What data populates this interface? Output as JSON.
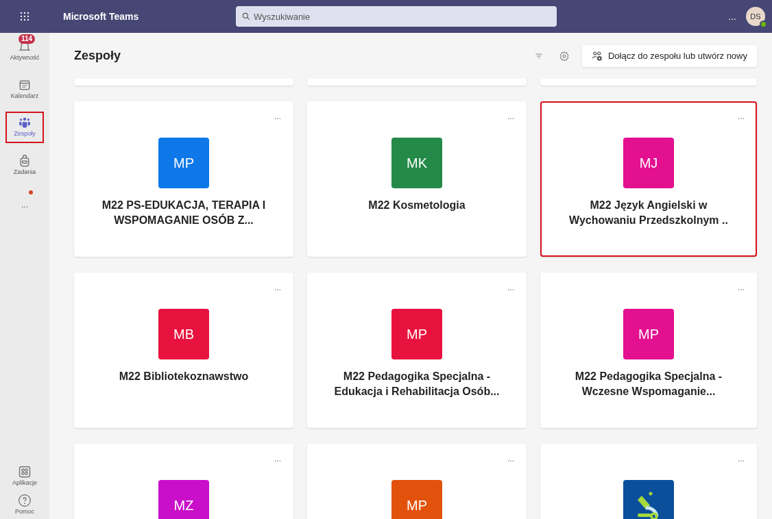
{
  "app_bar": {
    "title": "Microsoft Teams",
    "search": {
      "placeholder": "Wyszukiwanie"
    },
    "more": "...",
    "avatar": {
      "initials": "DS",
      "online": true
    }
  },
  "rail": [
    {
      "kind": "activity",
      "label": "Aktywność",
      "badge": "114",
      "selected": false,
      "highlighted": false
    },
    {
      "kind": "calendar",
      "label": "Kalendarz",
      "selected": false,
      "highlighted": false
    },
    {
      "kind": "teams",
      "label": "Zespoły",
      "selected": true,
      "highlighted": true
    },
    {
      "kind": "assignments",
      "label": "Zadania",
      "selected": false,
      "highlighted": false
    },
    {
      "kind": "more",
      "label": "...",
      "dot": true,
      "selected": false,
      "highlighted": false
    }
  ],
  "rail_bottom": [
    {
      "kind": "apps",
      "label": "Aplikacje"
    },
    {
      "kind": "help",
      "label": "Pomoc"
    }
  ],
  "header": {
    "title": "Zespoły",
    "join_button": "Dołącz do zespołu lub utwórz nowy"
  },
  "teams": [
    {
      "kind": "initials",
      "initials": "MP",
      "color": "#0f78e8",
      "name": "M22 PS-EDUKACJA, TERAPIA I WSPOMAGANIE OSÓB Z...",
      "more": "...",
      "highlighted": false
    },
    {
      "kind": "initials",
      "initials": "MK",
      "color": "#248a47",
      "name": "M22 Kosmetologia",
      "more": "...",
      "highlighted": false
    },
    {
      "kind": "initials",
      "initials": "MJ",
      "color": "#e3108f",
      "name": "M22 Język Angielski w Wychowaniu Przedszkolnym ..",
      "more": "...",
      "highlighted": true
    },
    {
      "kind": "initials",
      "initials": "MB",
      "color": "#e8123e",
      "name": "M22 Bibliotekoznawstwo",
      "more": "...",
      "highlighted": false
    },
    {
      "kind": "initials",
      "initials": "MP",
      "color": "#e8123e",
      "name": "M22 Pedagogika Specjalna - Edukacja i Rehabilitacja Osób...",
      "more": "...",
      "highlighted": false
    },
    {
      "kind": "initials",
      "initials": "MP",
      "color": "#e3108f",
      "name": "M22 Pedagogika Specjalna - Wczesne Wspomaganie...",
      "more": "...",
      "highlighted": false
    },
    {
      "kind": "initials",
      "initials": "MZ",
      "color": "#c90fc9",
      "more": "...",
      "highlighted": false
    },
    {
      "kind": "initials",
      "initials": "MP",
      "color": "#e2520c",
      "more": "...",
      "highlighted": false
    },
    {
      "kind": "image",
      "color": "#0b4f9c",
      "more": "...",
      "highlighted": false
    }
  ]
}
